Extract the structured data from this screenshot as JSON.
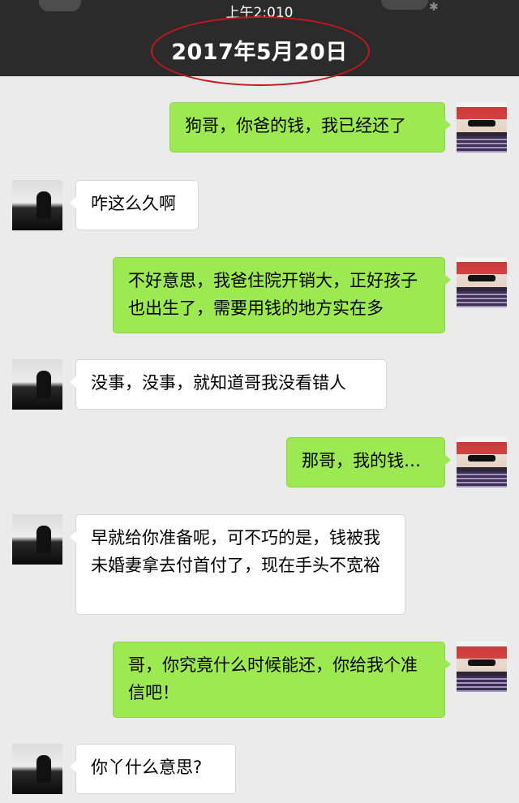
{
  "status_bar": {
    "time": "上午2:010"
  },
  "header": {
    "date": "2017年5月20日"
  },
  "colors": {
    "me_bubble": "#9de952",
    "friend_bubble": "#ffffff",
    "highlight_circle": "#c8161d"
  },
  "messages": [
    {
      "sender": "me",
      "text": "狗哥，你爸的钱，我已经还了"
    },
    {
      "sender": "friend",
      "text": "咋这么久啊"
    },
    {
      "sender": "me",
      "text": "不好意思，我爸住院开销大，正好孩子也出生了，需要用钱的地方实在多"
    },
    {
      "sender": "friend",
      "text": "没事，没事，就知道哥我没看错人"
    },
    {
      "sender": "me",
      "text": "那哥，我的钱…"
    },
    {
      "sender": "friend",
      "text": "早就给你准备呢，可不巧的是，钱被我未婚妻拿去付首付了，现在手头不宽裕"
    },
    {
      "sender": "me",
      "text": "哥，你究竟什么时候能还，你给我个准信吧！"
    },
    {
      "sender": "friend",
      "text": "你丫什么意思?"
    }
  ]
}
